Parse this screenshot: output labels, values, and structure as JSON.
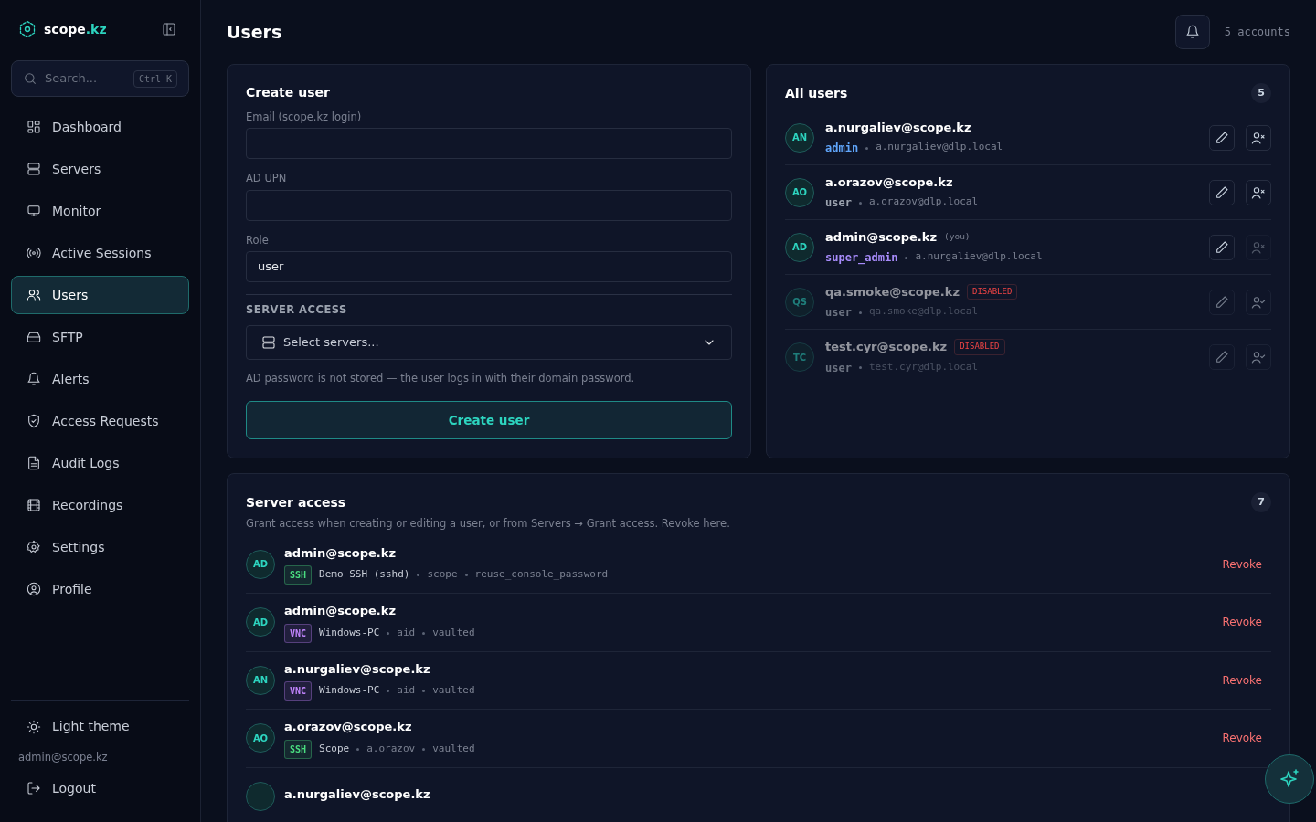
{
  "brand": {
    "name": "scope",
    "suffix": ".kz"
  },
  "search": {
    "placeholder": "Search...",
    "shortcut": "Ctrl K"
  },
  "sidebar": {
    "items": [
      {
        "label": "Dashboard",
        "selected": false
      },
      {
        "label": "Servers",
        "selected": false
      },
      {
        "label": "Monitor",
        "selected": false
      },
      {
        "label": "Active Sessions",
        "selected": false
      },
      {
        "label": "Users",
        "selected": true
      },
      {
        "label": "SFTP",
        "selected": false
      },
      {
        "label": "Alerts",
        "selected": false
      },
      {
        "label": "Access Requests",
        "selected": false
      },
      {
        "label": "Audit Logs",
        "selected": false
      },
      {
        "label": "Recordings",
        "selected": false
      },
      {
        "label": "Settings",
        "selected": false
      },
      {
        "label": "Profile",
        "selected": false
      }
    ],
    "theme_toggle": "Light theme",
    "account": "admin@scope.kz",
    "logout": "Logout"
  },
  "page": {
    "title": "Users",
    "accounts": "5 accounts"
  },
  "create_user": {
    "title": "Create user",
    "fields": [
      {
        "label": "Email (scope.kz login)"
      },
      {
        "label": "AD UPN"
      },
      {
        "label": "Role",
        "value": "user"
      }
    ],
    "server_access_label": "SERVER ACCESS",
    "servers_placeholder": "Select servers...",
    "note": "AD password is not stored — the user logs in with their domain password.",
    "submit": "Create user"
  },
  "all_users": {
    "title": "All users",
    "count": "5",
    "rows": [
      {
        "initials": "AN",
        "email": "a.nurgaliev@scope.kz",
        "role": {
          "text": "admin",
          "color": "#60a5fa"
        },
        "upn": "a.nurgaliev@dlp.local",
        "disabled": false,
        "remove_disabled": false
      },
      {
        "initials": "AO",
        "email": "a.orazov@scope.kz",
        "role": {
          "text": "user",
          "color": "#9ca3af"
        },
        "upn": "a.orazov@dlp.local",
        "disabled": false,
        "remove_disabled": false
      },
      {
        "initials": "AD",
        "email": "admin@scope.kz",
        "tag": "(you)",
        "role": {
          "text": "super_admin",
          "color": "#a78bfa"
        },
        "upn": "a.nurgaliev@dlp.local",
        "disabled": false,
        "remove_disabled": true
      },
      {
        "initials": "QS",
        "email": "qa.smoke@scope.kz",
        "badge": "DISABLED",
        "role": {
          "text": "user",
          "color": "#6b7280"
        },
        "upn": "qa.smoke@dlp.local",
        "disabled": true,
        "remove_disabled": false
      },
      {
        "initials": "TC",
        "email": "test.cyr@scope.kz",
        "badge": "DISABLED",
        "role": {
          "text": "user",
          "color": "#6b7280"
        },
        "upn": "test.cyr@dlp.local",
        "disabled": true,
        "remove_disabled": false
      }
    ]
  },
  "server_access": {
    "title": "Server access",
    "count": "7",
    "description": "Grant access when creating or editing a user, or from Servers → Grant access. Revoke here.",
    "rows": [
      {
        "initials": "AD",
        "user": "admin@scope.kz",
        "protocol": {
          "label": "SSH",
          "color": "#4ade80"
        },
        "server": "Demo SSH (sshd)",
        "details": [
          "scope",
          "reuse_console_password"
        ],
        "action": "Revoke"
      },
      {
        "initials": "AD",
        "user": "admin@scope.kz",
        "protocol": {
          "label": "VNC",
          "color": "#c084fc"
        },
        "server": "Windows-PC",
        "details": [
          "aid",
          "vaulted"
        ],
        "action": "Revoke"
      },
      {
        "initials": "AN",
        "user": "a.nurgaliev@scope.kz",
        "protocol": {
          "label": "VNC",
          "color": "#c084fc"
        },
        "server": "Windows-PC",
        "details": [
          "aid",
          "vaulted"
        ],
        "action": "Revoke"
      },
      {
        "initials": "AO",
        "user": "a.orazov@scope.kz",
        "protocol": {
          "label": "SSH",
          "color": "#4ade80"
        },
        "server": "Scope",
        "details": [
          "a.orazov",
          "vaulted"
        ],
        "action": "Revoke"
      },
      {
        "user": "a.nurgaliev@scope.kz"
      }
    ]
  }
}
